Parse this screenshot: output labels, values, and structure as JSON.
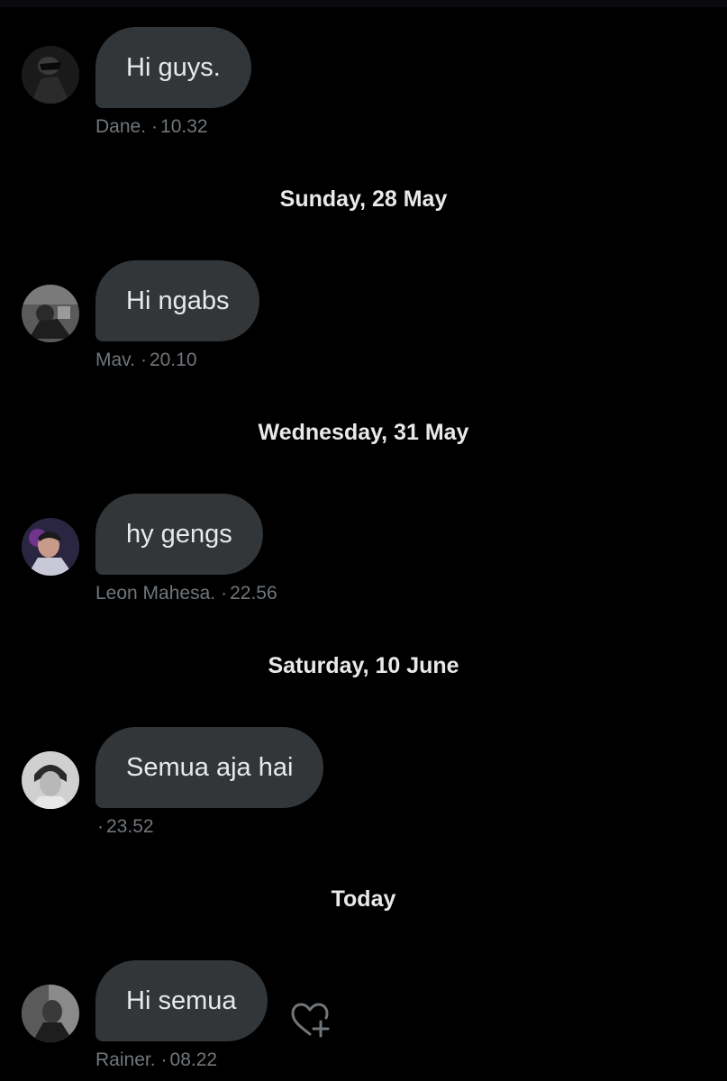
{
  "messages": [
    {
      "text": "Hi guys.",
      "sender": "Dane.",
      "time": "10.32",
      "avatar_icon": "avatar-dane"
    },
    {
      "text": "Hi ngabs",
      "sender": "Mav.",
      "time": "20.10",
      "avatar_icon": "avatar-mav"
    },
    {
      "text": "hy gengs",
      "sender": "Leon Mahesa.",
      "time": "22.56",
      "avatar_icon": "avatar-leon"
    },
    {
      "text": "Semua aja hai",
      "sender": "",
      "time": "23.52",
      "avatar_icon": "avatar-unknown"
    },
    {
      "text": "Hi semua",
      "sender": "Rainer.",
      "time": "08.22",
      "avatar_icon": "avatar-rainer"
    }
  ],
  "date_separators": [
    "Sunday, 28 May",
    "Wednesday, 31 May",
    "Saturday, 10 June",
    "Today"
  ],
  "meta_separator": "·",
  "icons": {
    "add_reaction": "heart-plus-icon"
  },
  "colors": {
    "background": "#000000",
    "bubble": "#333639",
    "text": "#e7e9ea",
    "meta": "#71767b"
  }
}
